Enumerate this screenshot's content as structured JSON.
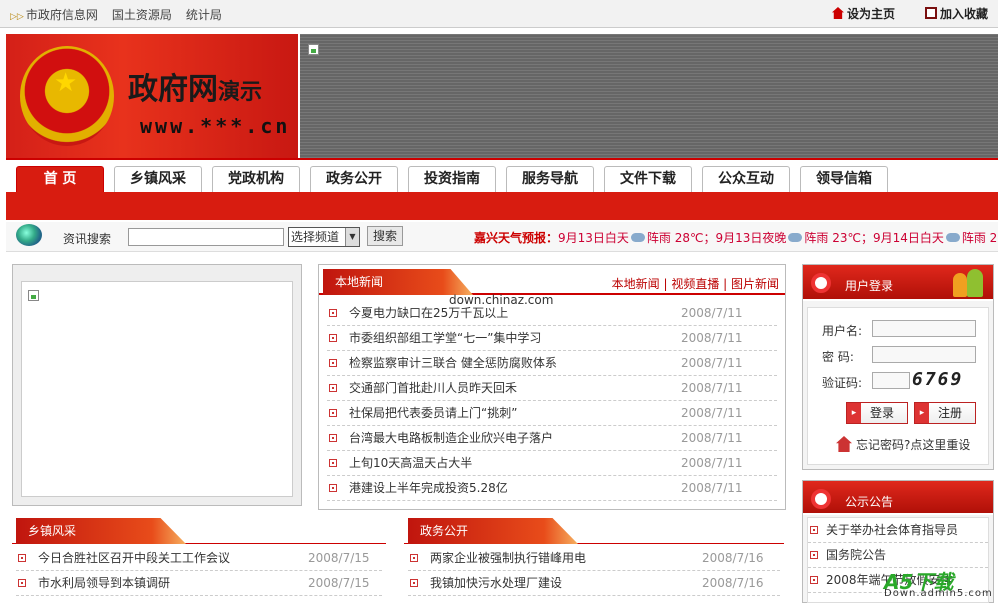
{
  "topbar": {
    "links": [
      "市政府信息网",
      "国土资源局",
      "统计局"
    ],
    "set_home": "设为主页",
    "add_favorite": "加入收藏"
  },
  "banner": {
    "title_big": "政府网",
    "title_small": "演示",
    "url": "www.***.cn"
  },
  "nav": {
    "tabs": [
      "首 页",
      "乡镇风采",
      "党政机构",
      "政务公开",
      "投资指南",
      "服务导航",
      "文件下载",
      "公众互动",
      "领导信箱"
    ]
  },
  "search": {
    "label": "资讯搜索",
    "select_value": "选择频道",
    "button": "搜索"
  },
  "weather": {
    "label": "嘉兴天气预报：",
    "d1": "9月13日白天",
    "c1": "阵雨 28℃；9月13日夜晚",
    "c2": "阵雨 23℃；9月14日白天",
    "c3": "阵雨 2"
  },
  "local_news": {
    "title": "本地新闻",
    "links": "本地新闻 | 视频直播 | 图片新闻",
    "watermark": "down.chinaz.com",
    "items": [
      {
        "title": "今夏电力缺口在25万千瓦以上",
        "date": "2008/7/11"
      },
      {
        "title": "市委组织部组工学堂“七一”集中学习",
        "date": "2008/7/11"
      },
      {
        "title": "检察监察审计三联合  健全惩防腐败体系",
        "date": "2008/7/11"
      },
      {
        "title": "交通部门首批赴川人员昨天回禾",
        "date": "2008/7/11"
      },
      {
        "title": "社保局把代表委员请上门“挑刺”",
        "date": "2008/7/11"
      },
      {
        "title": "台湾最大电路板制造企业欣兴电子落户",
        "date": "2008/7/11"
      },
      {
        "title": "上旬10天高温天占大半",
        "date": "2008/7/11"
      },
      {
        "title": "港建设上半年完成投资5.28亿",
        "date": "2008/7/11"
      }
    ]
  },
  "login": {
    "title": "用户登录",
    "username_label": "用户名:",
    "password_label": "密  码:",
    "captcha_label": "验证码:",
    "captcha": "6769",
    "login_btn": "登录",
    "register_btn": "注册",
    "forgot": "忘记密码?点这里重设"
  },
  "notice": {
    "title": "公示公告",
    "items": [
      "关于举办社会体育指导员",
      "国务院公告",
      "2008年端午节放假安排"
    ]
  },
  "township": {
    "title": "乡镇风采",
    "items": [
      {
        "title": "今日合胜社区召开中段关工工作会议",
        "date": "2008/7/15"
      },
      {
        "title": "市水利局领导到本镇调研",
        "date": "2008/7/15"
      }
    ]
  },
  "affairs": {
    "title": "政务公开",
    "items": [
      {
        "title": "两家企业被强制执行错峰用电",
        "date": "2008/7/16"
      },
      {
        "title": "我镇加快污水处理厂建设",
        "date": "2008/7/16"
      }
    ]
  },
  "watermark_site": {
    "brand": "A5下载",
    "url": "Down.admin5.com"
  },
  "colors": {
    "primary_red": "#d81c10",
    "accent_orange": "#e84c1a"
  }
}
